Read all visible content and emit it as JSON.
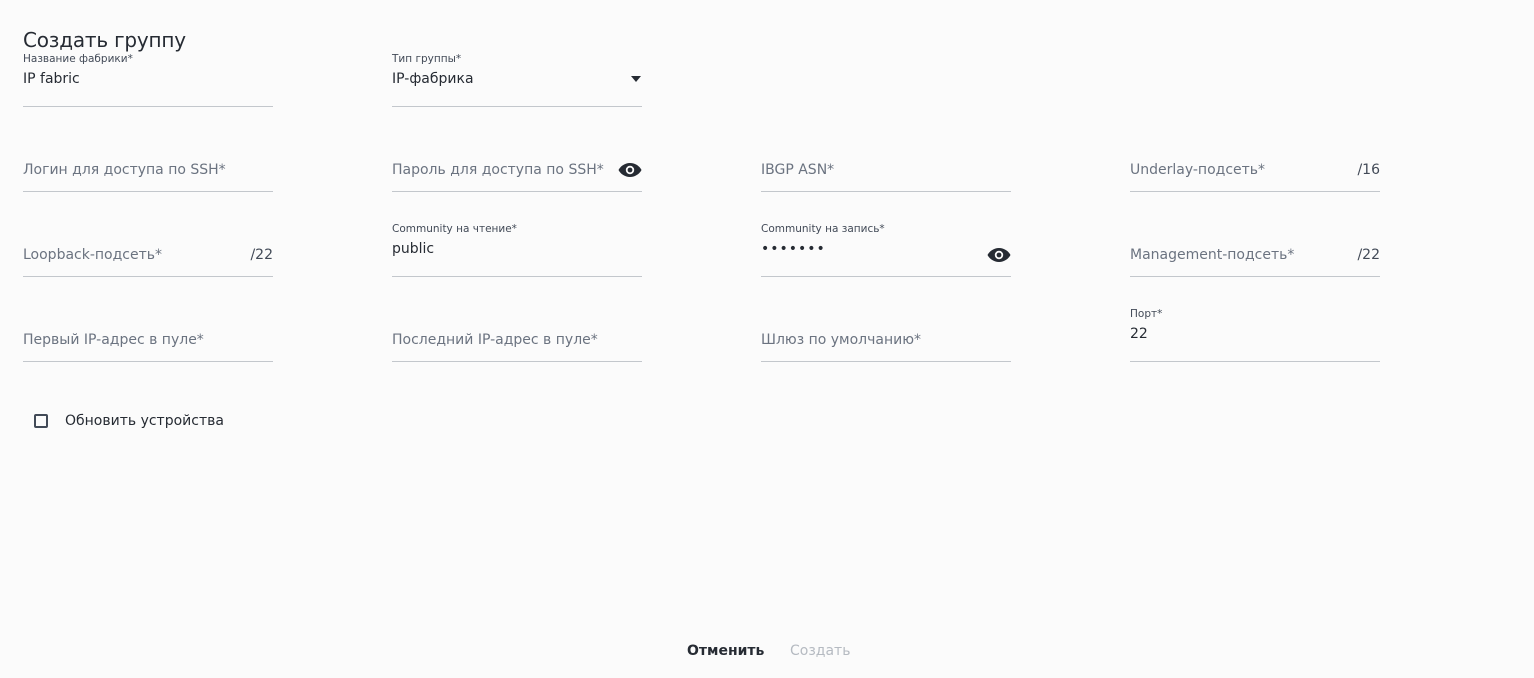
{
  "dialog": {
    "title": "Создать группу"
  },
  "fields": {
    "fabric_name": {
      "label": "Название фабрики*",
      "value": "IP fabric"
    },
    "group_type": {
      "label": "Тип группы*",
      "value": "IP-фабрика"
    },
    "ssh_login": {
      "placeholder": "Логин для доступа по SSH*"
    },
    "ssh_password": {
      "placeholder": "Пароль для доступа по SSH*"
    },
    "ibgp_asn": {
      "placeholder": "IBGP ASN*"
    },
    "underlay_subnet": {
      "placeholder": "Underlay-подсеть*",
      "suffix": "/16"
    },
    "loopback_subnet": {
      "placeholder": "Loopback-подсеть*",
      "suffix": "/22"
    },
    "community_read": {
      "label": "Community на чтение*",
      "value": "public"
    },
    "community_write": {
      "label": "Community на запись*",
      "value": "•••••••"
    },
    "management_subnet": {
      "placeholder": "Management-подсеть*",
      "suffix": "/22"
    },
    "first_ip": {
      "placeholder": "Первый IP-адрес в пуле*"
    },
    "last_ip": {
      "placeholder": "Последний IP-адрес в пуле*"
    },
    "gateway": {
      "placeholder": "Шлюз по умолчанию*"
    },
    "port": {
      "label": "Порт*",
      "value": "22"
    }
  },
  "checkbox": {
    "label": "Обновить устройства",
    "checked": false
  },
  "actions": {
    "cancel_label": "Отменить",
    "create_label": "Создать"
  },
  "icons": {
    "eye": "eye-icon",
    "dropdown": "triangle-down-icon",
    "checkbox": "checkbox-empty-icon"
  },
  "colors": {
    "text_primary": "#262b33",
    "text_secondary": "#6b7380",
    "underline": "#c3c7cc",
    "disabled": "#b5bac1",
    "background": "#fbfbfb"
  }
}
